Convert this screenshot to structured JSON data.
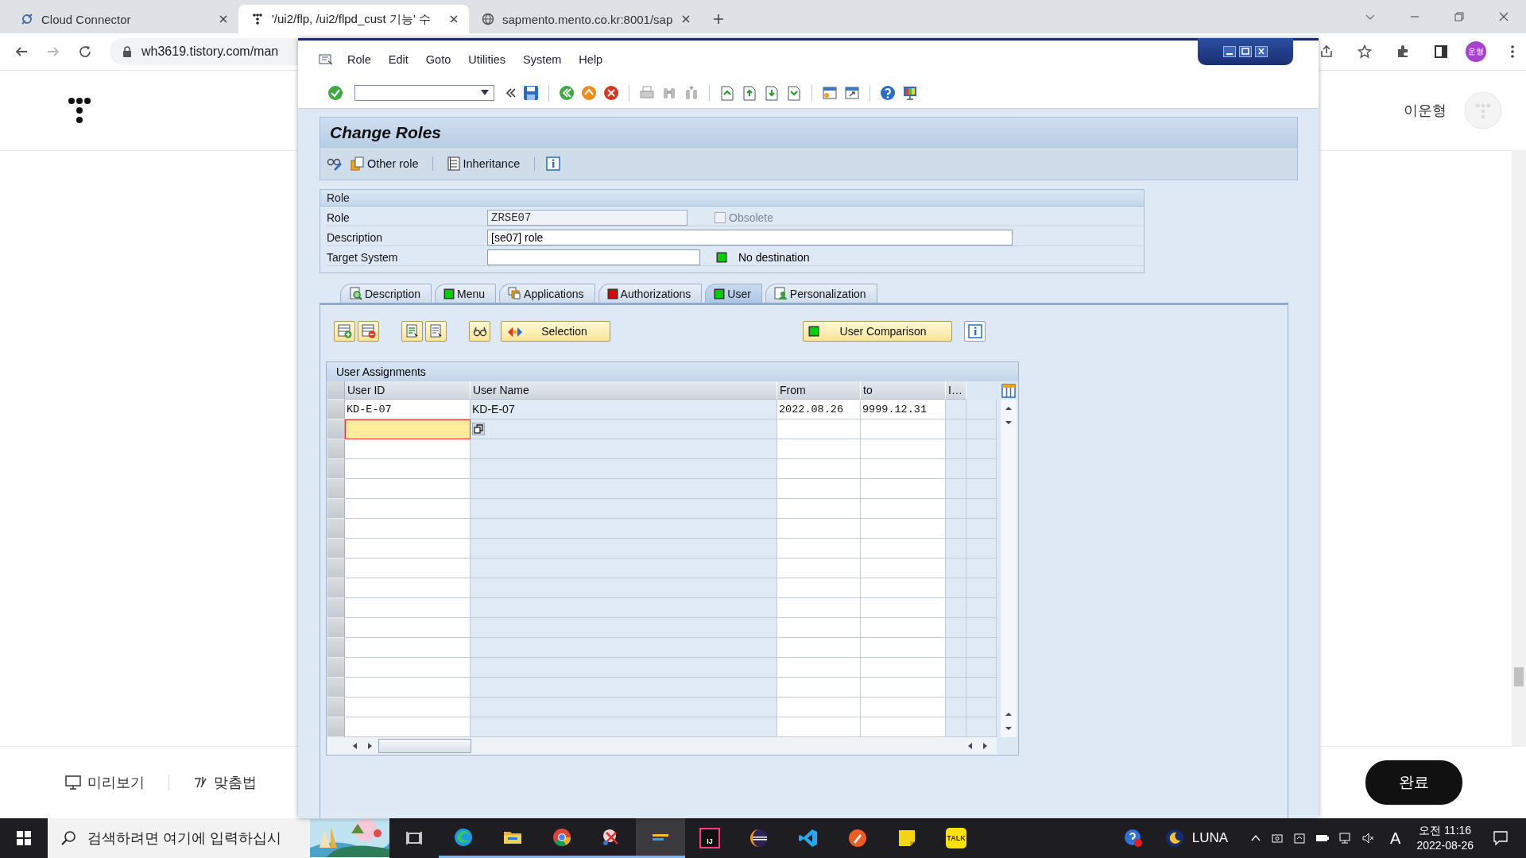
{
  "browser": {
    "tabs": [
      {
        "title": "Cloud Connector",
        "selected": false
      },
      {
        "title": "'/ui2/flp, /ui2/flpd_cust 기능' 수",
        "selected": true
      },
      {
        "title": "sapmento.mento.co.kr:8001/sap",
        "selected": false
      }
    ],
    "address": "wh3619.tistory.com/man",
    "profile": "운형"
  },
  "blog": {
    "user_name": "이운형",
    "preview": "미리보기",
    "spelling": "맞춤법",
    "done": "완료"
  },
  "sap_window": {
    "menu": [
      "Role",
      "Edit",
      "Goto",
      "Utilities",
      "System",
      "Help"
    ],
    "title": "Change Roles",
    "app_toolbar": [
      "Other role",
      "Inheritance"
    ],
    "role_group": {
      "title": "Role",
      "fields": [
        {
          "label": "Role",
          "value": "ZRSE07",
          "disabled": true
        },
        {
          "label": "Description",
          "value": "[se07] role",
          "disabled": false
        },
        {
          "label": "Target System",
          "disabled": false
        }
      ],
      "obsolete": {
        "label": "Obsolete",
        "checked": false,
        "disabled": true
      },
      "destination": "No destination"
    },
    "tabs": [
      {
        "label": "Description",
        "kind": "icon",
        "selected": false
      },
      {
        "label": "Menu",
        "kind": "status",
        "color": "#00cc00",
        "selected": false
      },
      {
        "label": "Applications",
        "kind": "icon",
        "selected": false
      },
      {
        "label": "Authorizations",
        "kind": "status",
        "color": "#e00000",
        "selected": false
      },
      {
        "label": "User",
        "kind": "status",
        "color": "#00cc00",
        "selected": true
      },
      {
        "label": "Personalization",
        "kind": "icon",
        "selected": false
      }
    ],
    "selection_button": "Selection",
    "comparison_button": "User Comparison",
    "table": {
      "title": "User Assignments",
      "columns": [
        "User ID",
        "User Name",
        "From",
        "to",
        "I…"
      ],
      "rows": [
        {
          "cells": [
            "KD-E-07",
            "KD-E-07",
            "2022.08.26",
            "9999.12.31"
          ]
        }
      ],
      "entry_row": {
        "focused": true
      }
    }
  },
  "taskbar": {
    "search_placeholder": "검색하려면 여기에 입력하십시",
    "intellij_label": "IJ",
    "kakao_label": "TALK",
    "tray_label": "LUNA",
    "ime": "A",
    "time": "오전 11:16",
    "date": "2022-08-26"
  }
}
